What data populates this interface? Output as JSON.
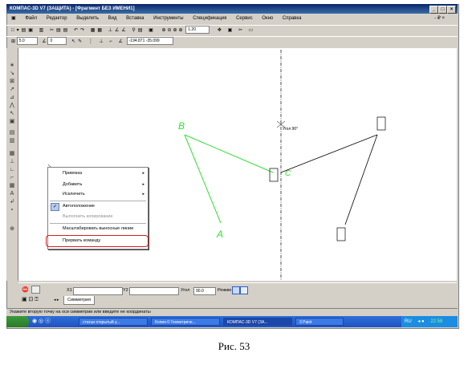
{
  "window": {
    "title": "КОМПАС-3D V7 (ЗАЩИТА) - [Фрагмент БЕЗ ИМЕНИ1]",
    "controls": [
      "_",
      "□",
      "×"
    ],
    "doc_controls": "- ₽ ×"
  },
  "menu": [
    "Файл",
    "Редактор",
    "Выделить",
    "Вид",
    "Вставка",
    "Инструменты",
    "Спецификация",
    "Сервис",
    "Окно",
    "Справка"
  ],
  "toolbar": {
    "zoom_value": "1.20",
    "step_value": "5.0",
    "angle_value": "0",
    "coords": "-194.871  -35.099"
  },
  "canvas": {
    "angle_label": "Угол 90°",
    "point_labels": {
      "a": "A",
      "b": "B",
      "c": "C"
    }
  },
  "context_menu": {
    "items": [
      {
        "label": "Привязка",
        "submenu": true
      },
      {
        "label": "Добавить",
        "submenu": true
      },
      {
        "label": "Исключить",
        "submenu": true
      },
      {
        "label": "Автоположение",
        "checked": true
      },
      {
        "label": "Выполнить копирование",
        "disabled": true
      },
      {
        "label": "Масштабировать выносные линии"
      },
      {
        "label": "Прервать команду",
        "highlighted": true
      }
    ]
  },
  "propbar": {
    "x1_label": "X1",
    "x1_value": "",
    "y2_label": "Y2",
    "angle_label": "Угол",
    "angle_value": "90.0",
    "mode_label": "Режим",
    "tab_label": "Симметрия"
  },
  "status_text": "Укажите вторую точку на оси симметрии или введите ее координаты",
  "taskbar": {
    "tasks": [
      "статьи открытый у...",
      "Копия 0 Геометриче...",
      "КОМПАС-3D V7 (ЗА...",
      "3 Paint"
    ],
    "lang": "RU",
    "time": "22:58"
  },
  "caption": "Рис. 53",
  "colors": {
    "accent": "#0a246a",
    "highlight_circle": "#d42020",
    "green_line": "#33dd33"
  }
}
